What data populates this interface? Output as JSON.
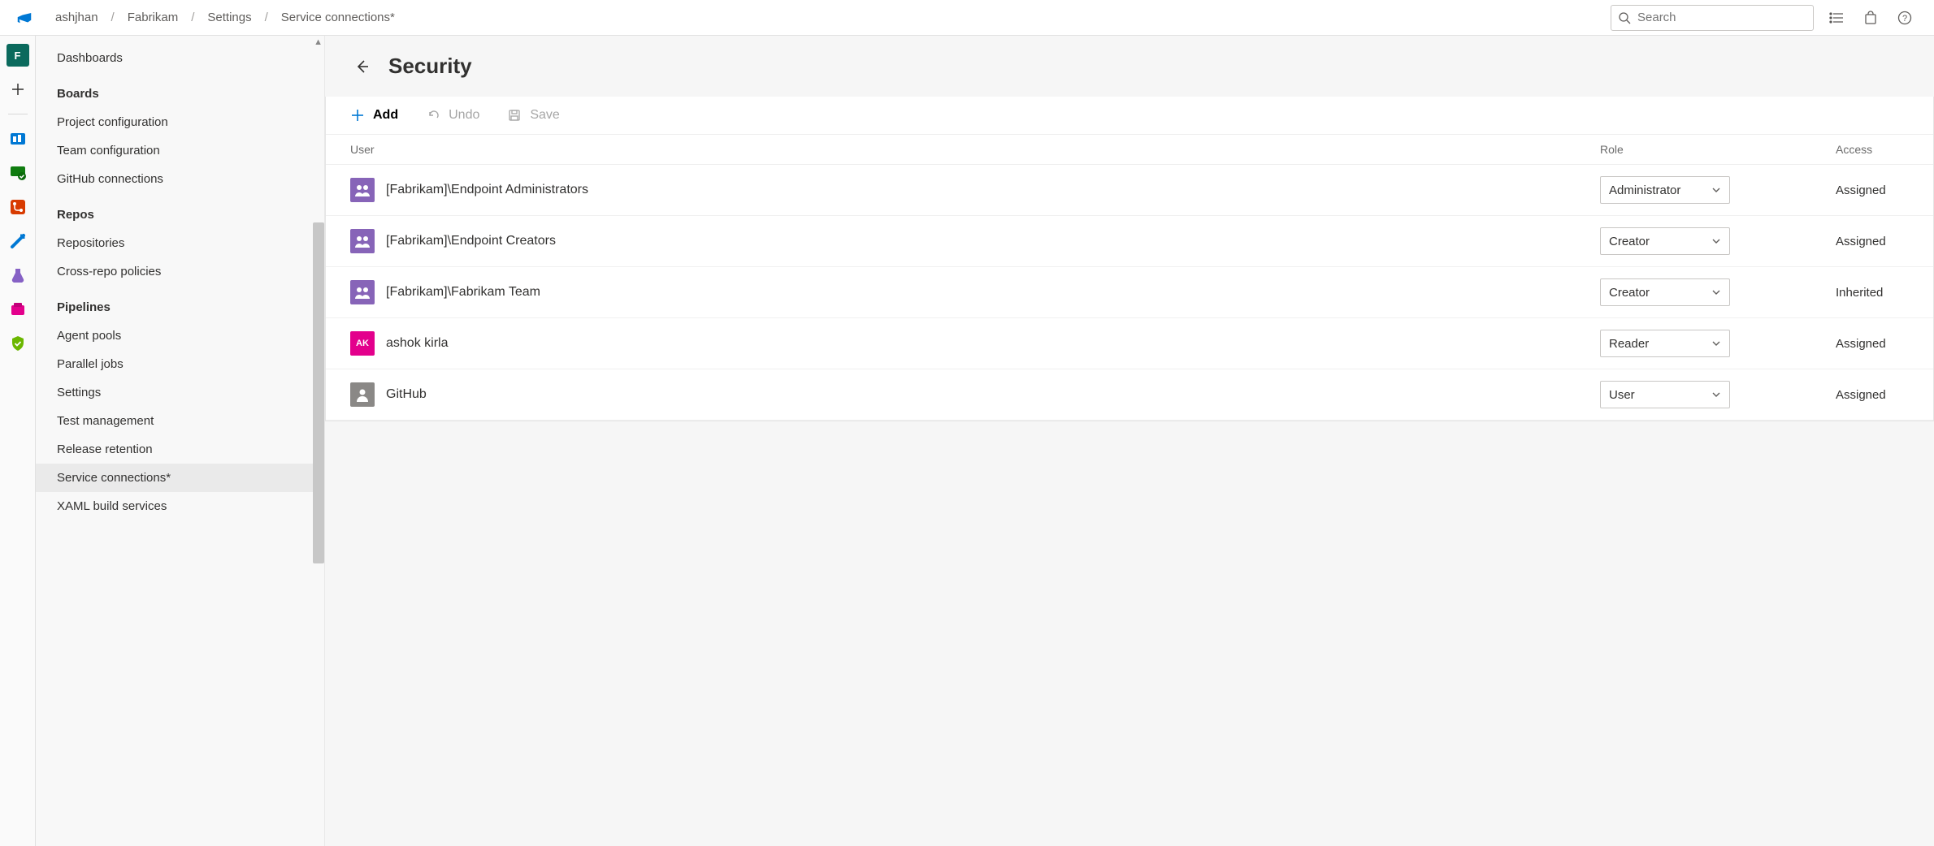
{
  "breadcrumbs": [
    "ashjhan",
    "Fabrikam",
    "Settings",
    "Service connections*"
  ],
  "search_placeholder": "Search",
  "rail": {
    "project_initial": "F",
    "project_color": "#0b6a5d"
  },
  "sidebar": {
    "groups": [
      {
        "header": null,
        "items": [
          "Dashboards"
        ]
      },
      {
        "header": "Boards",
        "items": [
          "Project configuration",
          "Team configuration",
          "GitHub connections"
        ]
      },
      {
        "header": "Repos",
        "items": [
          "Repositories",
          "Cross-repo policies"
        ]
      },
      {
        "header": "Pipelines",
        "items": [
          "Agent pools",
          "Parallel jobs",
          "Settings",
          "Test management",
          "Release retention",
          "Service connections*",
          "XAML build services"
        ]
      }
    ],
    "active": "Service connections*"
  },
  "page": {
    "title": "Security",
    "toolbar": {
      "add": "Add",
      "undo": "Undo",
      "save": "Save"
    },
    "columns": {
      "user": "User",
      "role": "Role",
      "access": "Access"
    },
    "rows": [
      {
        "avatar": "group",
        "label": "[Fabrikam]\\Endpoint Administrators",
        "role": "Administrator",
        "access": "Assigned"
      },
      {
        "avatar": "group",
        "label": "[Fabrikam]\\Endpoint Creators",
        "role": "Creator",
        "access": "Assigned"
      },
      {
        "avatar": "group",
        "label": "[Fabrikam]\\Fabrikam Team",
        "role": "Creator",
        "access": "Inherited"
      },
      {
        "avatar": "pink",
        "initials": "AK",
        "label": "ashok kirla",
        "role": "Reader",
        "access": "Assigned"
      },
      {
        "avatar": "gray",
        "label": "GitHub",
        "role": "User",
        "access": "Assigned"
      }
    ]
  }
}
